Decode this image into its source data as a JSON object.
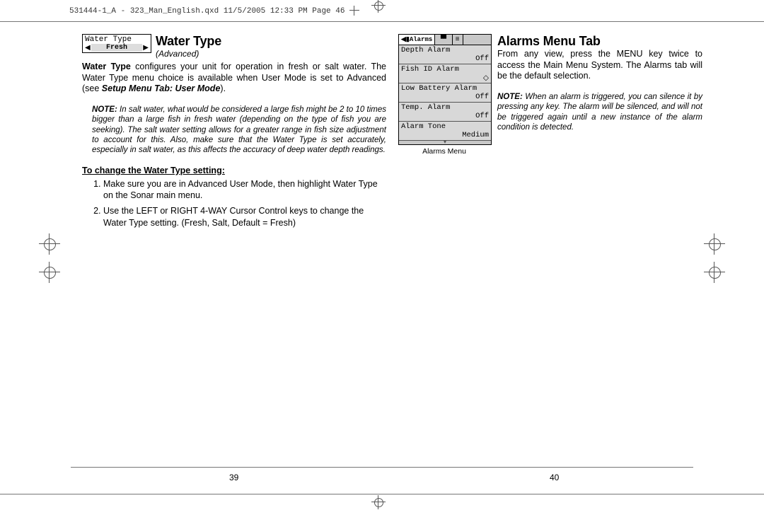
{
  "file_header": "531444-1_A - 323_Man_English.qxd  11/5/2005  12:33 PM  Page 46",
  "left": {
    "graphic": {
      "title": "Water Type",
      "value": "Fresh"
    },
    "heading": "Water Type",
    "sub": "(Advanced)",
    "p1_a": "Water Type",
    "p1_b": " configures your unit for operation in fresh or salt water. The Water Type menu choice is available when User Mode is set to Advanced (see ",
    "p1_ref": "Setup Menu Tab: User Mode",
    "p1_c": ").",
    "note_lead": "NOTE:",
    "note_body": " In salt water, what would be considered a large fish might be 2 to 10 times bigger than a large fish in fresh water (depending on the type of fish you are seeking). The salt water setting allows for a greater range in fish size adjustment to account for this. Also, make sure that the Water Type is set accurately, especially in salt water, as this affects the accuracy of deep water depth readings.",
    "subhead": "To change the Water Type setting:",
    "steps": [
      "Make sure you are in Advanced User Mode, then highlight Water Type on the Sonar main menu.",
      "Use the LEFT or RIGHT 4-WAY Cursor Control keys to change the Water Type setting. (Fresh, Salt, Default = Fresh)"
    ],
    "pagenum": "39"
  },
  "right": {
    "heading": "Alarms Menu Tab",
    "alarms_tab_label": "Alarms",
    "rows": [
      {
        "label": "Depth Alarm",
        "value": "Off"
      },
      {
        "label": "Fish ID Alarm",
        "value": "◇"
      },
      {
        "label": "Low Battery Alarm",
        "value": "Off"
      },
      {
        "label": "Temp. Alarm",
        "value": "Off"
      },
      {
        "label": "Alarm Tone",
        "value": "Medium"
      }
    ],
    "caption": "Alarms Menu",
    "p1": "From any view, press the MENU key twice to access the Main Menu System. The Alarms tab will be the default selection.",
    "note_lead": "NOTE:",
    "note_body": " When an alarm is triggered, you can silence it by pressing any key. The alarm will be silenced, and will not be triggered again until a new instance of the alarm condition is detected.",
    "pagenum": "40"
  }
}
